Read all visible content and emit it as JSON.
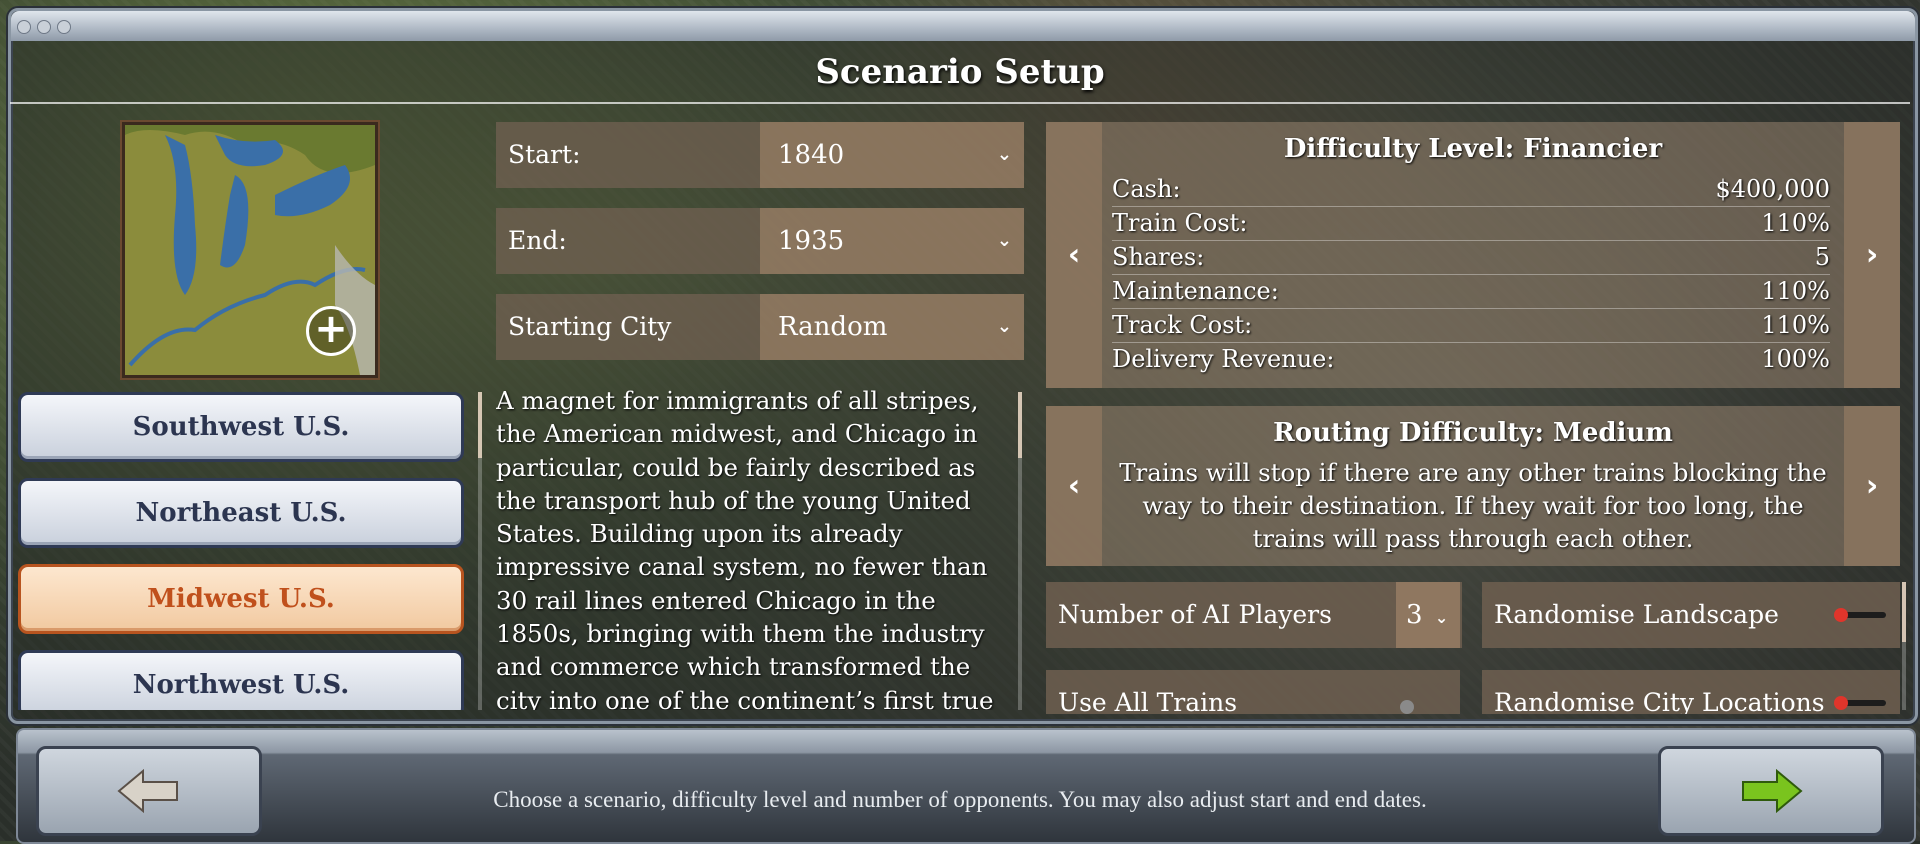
{
  "title": "Scenario Setup",
  "map": {
    "zoom_icon": "plus-circle-icon"
  },
  "regions": [
    {
      "label": "Southwest U.S.",
      "active": false
    },
    {
      "label": "Northeast U.S.",
      "active": false
    },
    {
      "label": "Midwest U.S.",
      "active": true
    },
    {
      "label": "Northwest U.S.",
      "active": false
    }
  ],
  "settings": {
    "start": {
      "label": "Start:",
      "value": "1840"
    },
    "end": {
      "label": "End:",
      "value": "1935"
    },
    "city": {
      "label": "Starting City",
      "value": "Random"
    }
  },
  "description": "A magnet for immigrants of all stripes, the American midwest, and Chicago in particular, could be fairly described as the transport hub of the young United States. Building upon its already impressive canal system, no fewer than 30 rail lines entered Chicago in the 1850s, bringing with them the industry and commerce which transformed the city into one of the continent’s first true metropolises.",
  "difficulty": {
    "heading": "Difficulty Level: Financier",
    "stats": [
      {
        "name": "Cash:",
        "value": "$400,000"
      },
      {
        "name": "Train Cost:",
        "value": "110%"
      },
      {
        "name": "Shares:",
        "value": "5"
      },
      {
        "name": "Maintenance:",
        "value": "110%"
      },
      {
        "name": "Track Cost:",
        "value": "110%"
      },
      {
        "name": "Delivery Revenue:",
        "value": "100%"
      }
    ]
  },
  "routing": {
    "heading": "Routing Difficulty: Medium",
    "text": "Trains will stop if there are any other trains blocking the way to their destination. If they wait for too long, the trains will pass through each other."
  },
  "options": {
    "ai_players_label": "Number of AI Players",
    "ai_players_value": "3",
    "randomise_landscape": "Randomise Landscape",
    "use_all_trains": "Use All Trains",
    "randomise_city_locations": "Randomise City Locations"
  },
  "footer": {
    "hint": "Choose a scenario, difficulty level and number of opponents. You may also adjust start and end dates."
  },
  "colors": {
    "accent_active": "#c0501c",
    "next_arrow": "#7ac41e",
    "toggle_on": "#e0352b"
  }
}
